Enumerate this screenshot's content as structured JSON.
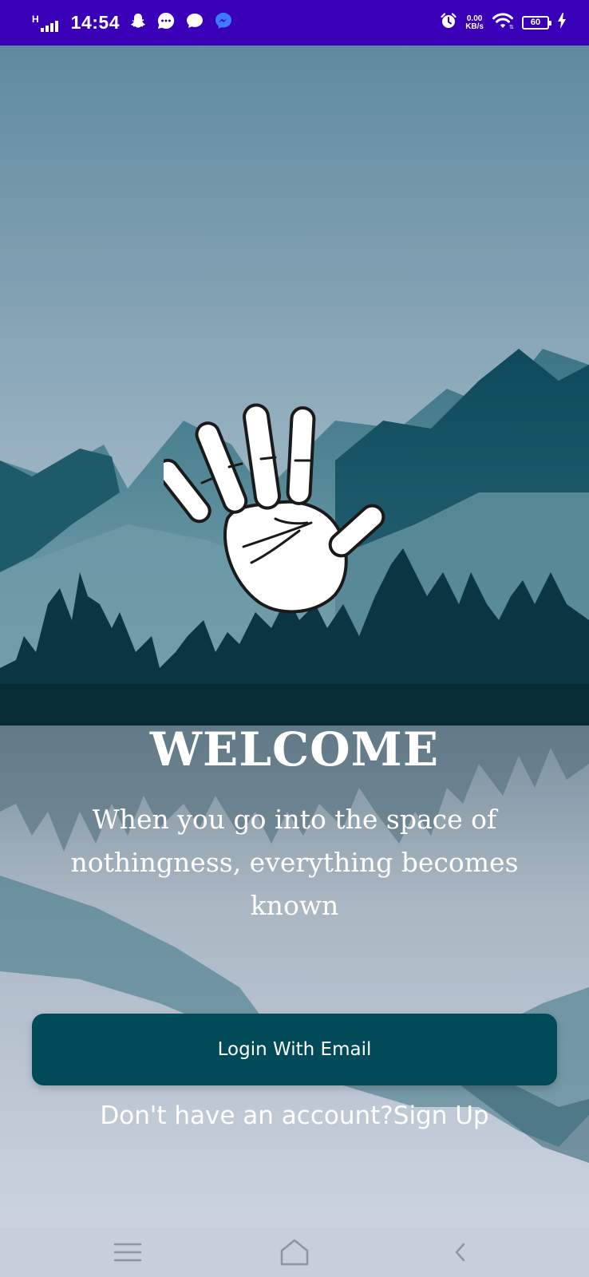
{
  "status_bar": {
    "signal_type": "H",
    "time": "14:54",
    "net_speed_value": "0.00",
    "net_speed_unit": "KB/s",
    "battery_level": "60",
    "icons": [
      "signal-icon",
      "snapchat-icon",
      "chat-icon",
      "message-icon",
      "messenger-icon",
      "alarm-icon",
      "wifi-icon",
      "battery-icon",
      "charging-icon"
    ],
    "color": "#3a00b8"
  },
  "main": {
    "logo": "hand-print-icon",
    "title": "WELCOME",
    "quote": "When you go into the space of nothingness, everything becomes known",
    "login_button_label": "Login With Email",
    "signup_prompt": "Don't have an account?",
    "signup_link": "Sign Up"
  },
  "nav_bar": {
    "buttons": [
      "menu-icon",
      "home-icon",
      "back-icon"
    ]
  },
  "colors": {
    "button": "#004a5a",
    "text": "#ffffff",
    "sky_top": "#5f8a9e",
    "sky_bottom": "#b6c7d2"
  }
}
